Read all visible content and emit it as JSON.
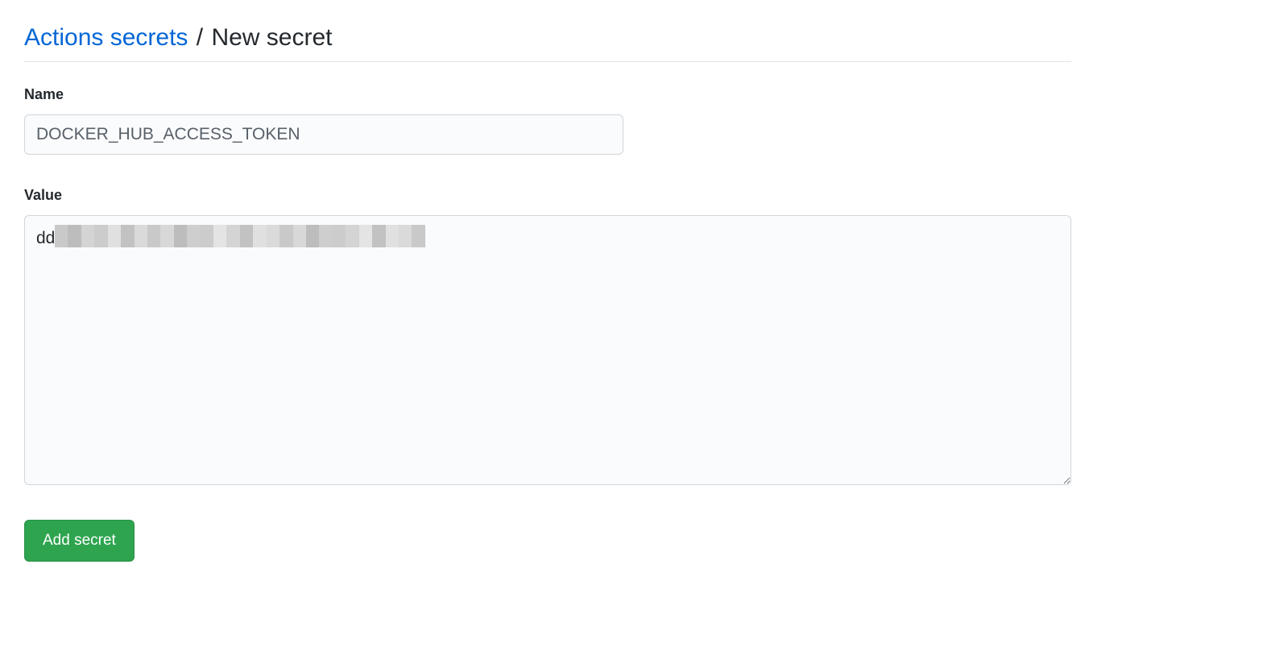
{
  "breadcrumb": {
    "parent": "Actions secrets",
    "separator": "/",
    "current": "New secret"
  },
  "form": {
    "name_label": "Name",
    "name_value": "DOCKER_HUB_ACCESS_TOKEN",
    "value_label": "Value",
    "value_visible_prefix": "dd",
    "submit_label": "Add secret"
  }
}
